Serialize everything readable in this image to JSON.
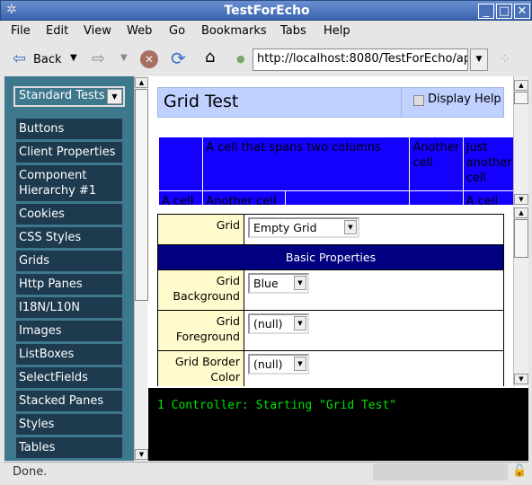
{
  "window": {
    "title": "TestForEcho"
  },
  "menu": [
    "File",
    "Edit",
    "View",
    "Web",
    "Go",
    "Bookmarks",
    "Tabs",
    "Help"
  ],
  "toolbar": {
    "back_label": "Back",
    "url": "http://localhost:8080/TestForEcho/ap"
  },
  "sidebar": {
    "category": "Standard Tests",
    "items": [
      "Buttons",
      "Client Properties",
      "Component Hierarchy #1",
      "Cookies",
      "CSS Styles",
      "Grids",
      "Http Panes",
      "I18N/L10N",
      "Images",
      "ListBoxes",
      "SelectFields",
      "Stacked Panes",
      "Styles",
      "Tables"
    ]
  },
  "header": {
    "title": "Grid Test",
    "display_help": "Display Help",
    "display_help_checked": false
  },
  "grid": {
    "color": "#1400ff",
    "row1": [
      "",
      "A cell that spans two columns",
      "Another cell",
      "Just another cell"
    ],
    "row2": [
      "A cell",
      "Another cell",
      "",
      "",
      "A cell"
    ]
  },
  "props": {
    "grid_label": "Grid",
    "grid_value": "Empty Grid",
    "section": "Basic Properties",
    "rows": [
      {
        "label": "Grid Background",
        "value": "Blue"
      },
      {
        "label": "Grid Foreground",
        "value": "(null)"
      },
      {
        "label": "Grid Border Color",
        "value": "(null)"
      }
    ]
  },
  "console": {
    "line": "1 Controller: Starting \"Grid Test\""
  },
  "status": {
    "text": "Done."
  }
}
